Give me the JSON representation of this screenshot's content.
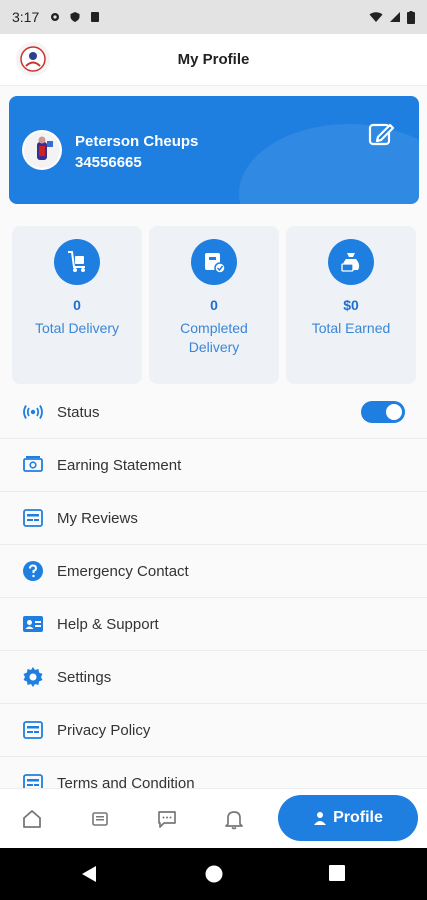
{
  "status_bar": {
    "time": "3:17"
  },
  "header": {
    "title": "My Profile"
  },
  "profile": {
    "name": "Peterson Cheups",
    "phone": "34556665"
  },
  "stats": [
    {
      "value": "0",
      "label": "Total Delivery",
      "icon": "cart-icon"
    },
    {
      "value": "0",
      "label": "Completed Delivery",
      "icon": "box-check-icon"
    },
    {
      "value": "$0",
      "label": "Total Earned",
      "icon": "money-bag-icon"
    }
  ],
  "menu": [
    {
      "label": "Status",
      "icon": "broadcast-icon",
      "toggle_on": true
    },
    {
      "label": "Earning Statement",
      "icon": "cash-icon"
    },
    {
      "label": "My Reviews",
      "icon": "document-list-icon"
    },
    {
      "label": "Emergency Contact",
      "icon": "question-icon"
    },
    {
      "label": "Help & Support",
      "icon": "contact-card-icon"
    },
    {
      "label": "Settings",
      "icon": "gear-icon"
    },
    {
      "label": "Privacy Policy",
      "icon": "document-list-icon"
    },
    {
      "label": "Terms and Condition",
      "icon": "document-list-icon"
    }
  ],
  "bottom_nav": {
    "active_label": "Profile"
  },
  "colors": {
    "primary": "#1f7fe0",
    "stat_bg": "#eef2f7",
    "accent_text": "#3a86d6"
  }
}
